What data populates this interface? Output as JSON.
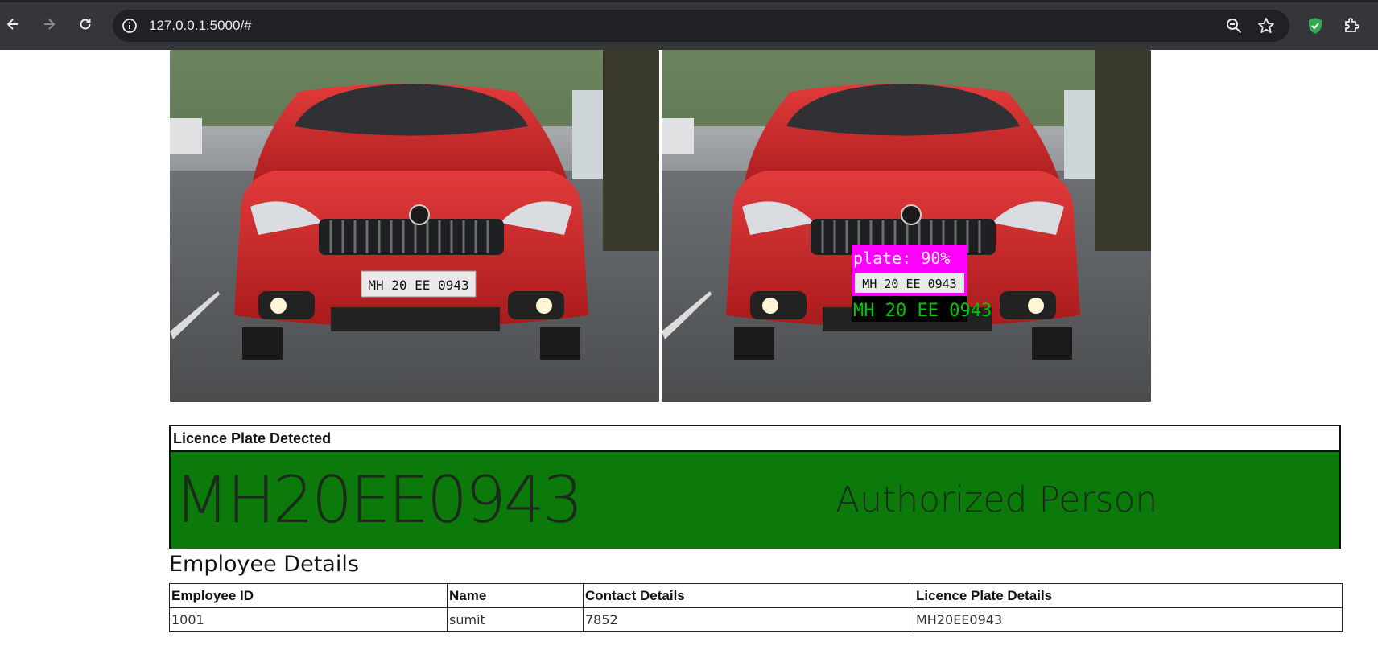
{
  "browser": {
    "url": "127.0.0.1:5000/#",
    "icons": [
      "back-icon",
      "forward-icon",
      "reload-icon",
      "site-info-icon",
      "zoom-icon",
      "bookmark-star-icon",
      "shield-extension-icon",
      "extensions-puzzle-icon"
    ]
  },
  "images": {
    "original_plate_text": "MH 20  EE  0943",
    "detection_label": "plate: 90%",
    "detected_plate_text": "MH 20  EE  0943",
    "ocr_result_text": "MH 20 EE 0943"
  },
  "detection": {
    "caption": "Licence Plate Detected",
    "plate_number": "MH20EE0943",
    "status": "Authorized Person",
    "status_color": "#0b7a0b"
  },
  "employee_details": {
    "title": "Employee Details",
    "columns": [
      "Employee ID",
      "Name",
      "Contact Details",
      "Licence Plate Details"
    ],
    "rows": [
      [
        "1001",
        "sumit",
        "7852",
        "MH20EE0943"
      ]
    ]
  }
}
